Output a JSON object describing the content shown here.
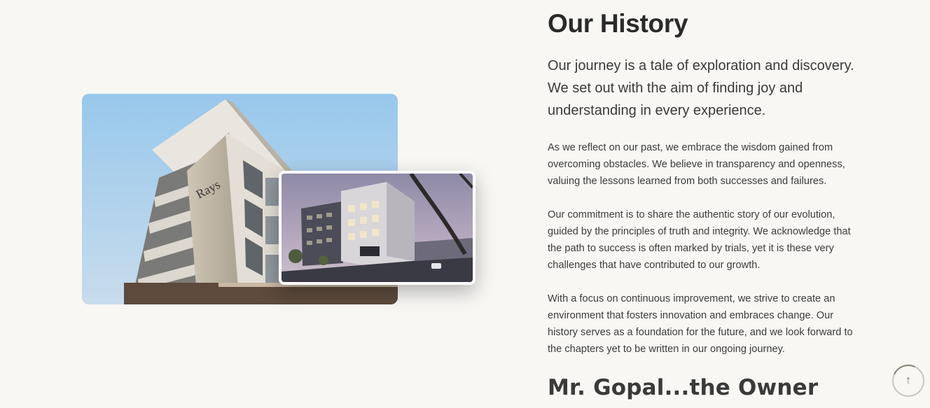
{
  "history": {
    "title": "Our History",
    "lead": "Our journey is a tale of exploration and discovery. We set out with the aim of finding joy and understanding in every experience.",
    "paragraphs": [
      "As we reflect on our past, we embrace the wisdom gained from overcoming obstacles. We believe in transparency and openness, valuing the lessons learned from both successes and failures.",
      "Our commitment is to share the authentic story of our evolution, guided by the principles of truth and integrity. We acknowledge that the path to success is often marked by trials, yet it is these very challenges that have contributed to our growth.",
      "With a focus on continuous improvement, we strive to create an environment that fosters innovation and embraces change. Our history serves as a foundation for the future, and we look forward to the chapters yet to be written in our ongoing journey."
    ],
    "owner_heading": "Mr. Gopal...the Owner"
  },
  "images": {
    "main_sign": "Rays",
    "main_icon": "hotel-building-photo",
    "inset_icon": "hotel-rendering-photo"
  },
  "scroll_top": {
    "icon": "arrow-up-icon",
    "glyph": "↑"
  },
  "colors": {
    "background": "#f8f7f4",
    "heading": "#2a2a2a",
    "text": "#3c3c3c"
  }
}
